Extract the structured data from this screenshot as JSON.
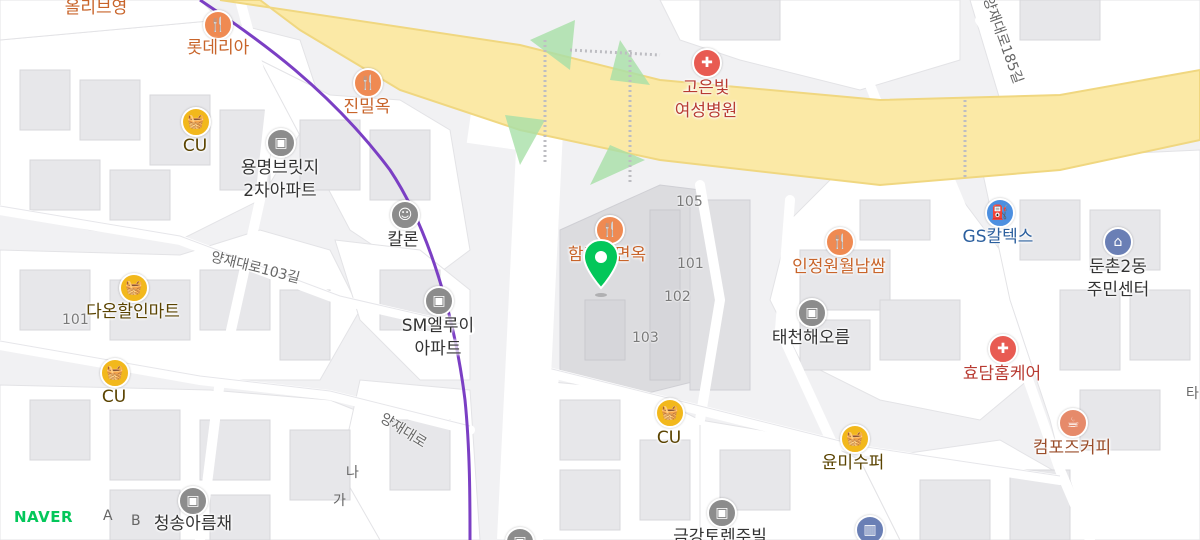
{
  "brand": {
    "logo": "NAVER",
    "color": "#03c75a"
  },
  "colors": {
    "main_road": "#fbe9a6",
    "road_edge": "#f0d780",
    "subway_line": "#7b3fc4",
    "block": "#ffffff",
    "building": "#e4e4e7",
    "background": "#f1f1f3",
    "marker": "#03c75a"
  },
  "roads": {
    "yangjae_103": "양재대로103길",
    "yangjae": "양재대로",
    "yangjae_185": "양재대로185길"
  },
  "places": {
    "oliveyoung": "올리브영",
    "lotteria": "롯데리아",
    "jinmilok": "진밀옥",
    "cu1": "CU",
    "yongmyeong_line1": "용명브릿지",
    "yongmyeong_line2": "2차아파트",
    "kalron": "칼론",
    "daon_mart": "다온할인마트",
    "sm_line1": "SM엘루이",
    "sm_line2": "아파트",
    "cu2": "CU",
    "cheongsong": "청송아름채",
    "goeun_line1": "고은빛",
    "goeun_line2": "여성병원",
    "hamheung": "함흥냉면옥",
    "cu3": "CU",
    "injeong": "인정원월남쌈",
    "taecheon": "태천해오름",
    "gs": "GS칼텍스",
    "dunchon_line1": "둔촌2동",
    "dunchon_line2": "주민센터",
    "hyodam": "효담홈케어",
    "yunmi": "윤미수퍼",
    "compose": "컴포즈커피",
    "geumgang": "금강토렌주빌"
  },
  "building_numbers": {
    "n105": "105",
    "n101": "101",
    "n102": "102",
    "n103": "103",
    "n101b": "101"
  },
  "labels": {
    "na": "나",
    "ga": "가",
    "a": "A",
    "b": "B",
    "ta": "타"
  },
  "icons": [
    "restaurant-icon",
    "convenience-store-icon",
    "building-icon",
    "hospital-icon",
    "gas-station-icon",
    "cafe-icon",
    "government-icon",
    "location-marker-icon"
  ]
}
